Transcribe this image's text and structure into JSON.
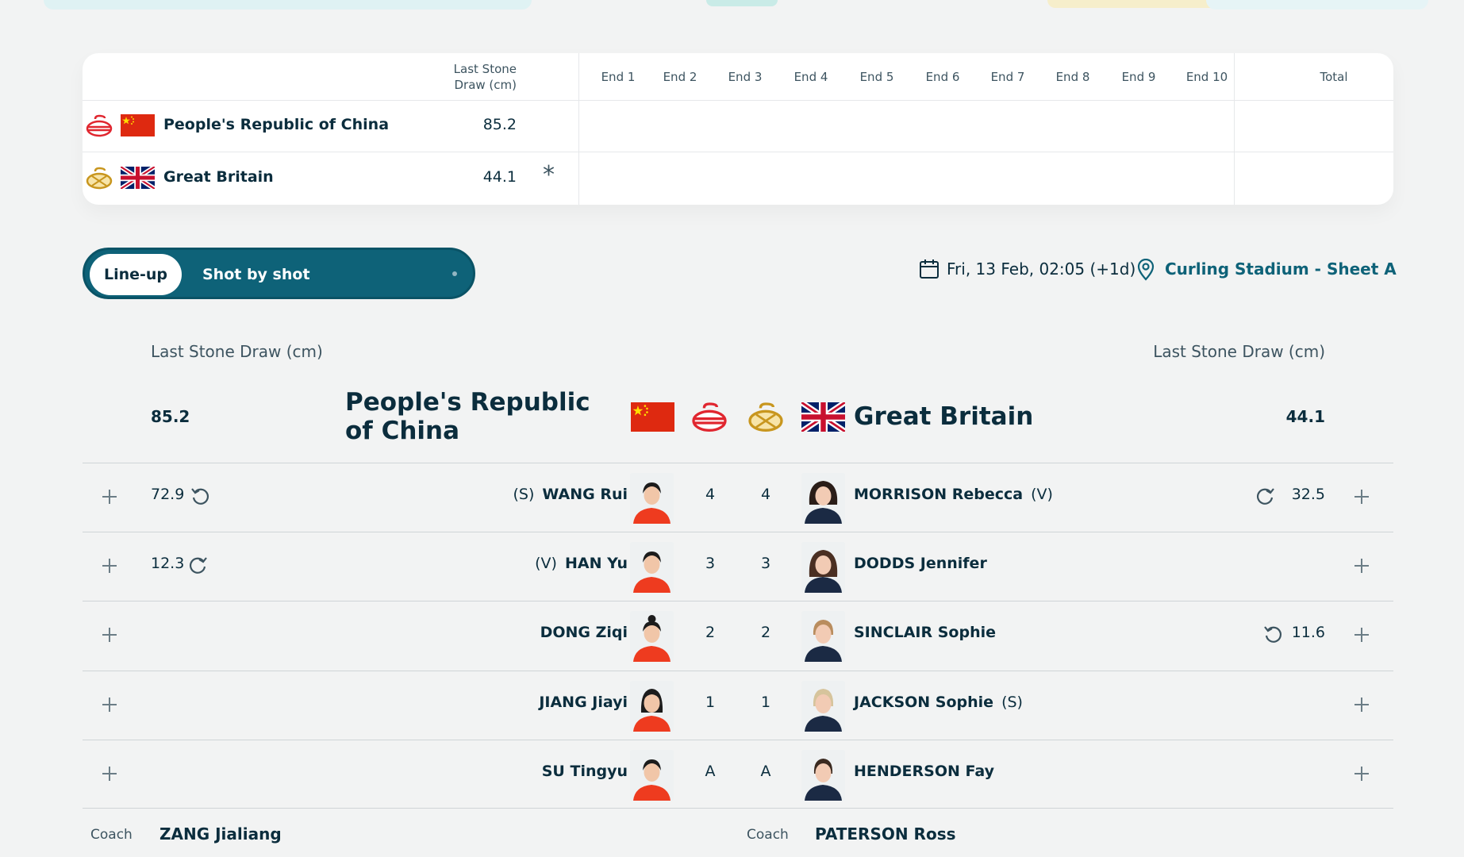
{
  "scoreboard": {
    "lsd_header": "Last Stone Draw (cm)",
    "ends": [
      "End 1",
      "End 2",
      "End 3",
      "End 4",
      "End 5",
      "End 6",
      "End 7",
      "End 8",
      "End 9",
      "End 10"
    ],
    "total_header": "Total",
    "hammer_symbol": "*",
    "teams": [
      {
        "name": "People's Republic of China",
        "lsd": "85.2",
        "stone_color": "#e0262f",
        "flag": "cn-flag"
      },
      {
        "name": "Great Britain",
        "lsd": "44.1",
        "stone_color": "#c8961e",
        "flag": "gb-flag"
      }
    ]
  },
  "toggle": {
    "active": "Line-up",
    "inactive": "Shot by shot"
  },
  "match_info": {
    "date": "Fri, 13 Feb, 02:05 (+1d)",
    "venue": "Curling Stadium - Sheet A"
  },
  "lineup": {
    "lsd_label": "Last Stone Draw (cm)",
    "left_team": {
      "name": "People's Republic of China",
      "lsd": "85.2"
    },
    "right_team": {
      "name": "Great Britain",
      "lsd": "44.1"
    },
    "rows": [
      {
        "left_shot": "72.9",
        "left_role": "(S)",
        "left_name": "WANG Rui",
        "left_pos": "4",
        "right_pos": "4",
        "right_name": "MORRISON Rebecca",
        "right_role": "(V)",
        "right_shot": "32.5"
      },
      {
        "left_shot": "12.3",
        "left_role": "(V)",
        "left_name": "HAN Yu",
        "left_pos": "3",
        "right_pos": "3",
        "right_name": "DODDS Jennifer",
        "right_role": "",
        "right_shot": ""
      },
      {
        "left_shot": "",
        "left_role": "",
        "left_name": "DONG Ziqi",
        "left_pos": "2",
        "right_pos": "2",
        "right_name": "SINCLAIR Sophie",
        "right_role": "",
        "right_shot": "11.6"
      },
      {
        "left_shot": "",
        "left_role": "",
        "left_name": "JIANG Jiayi",
        "left_pos": "1",
        "right_pos": "1",
        "right_name": "JACKSON Sophie",
        "right_role": "(S)",
        "right_shot": ""
      },
      {
        "left_shot": "",
        "left_role": "",
        "left_name": "SU Tingyu",
        "left_pos": "A",
        "right_pos": "A",
        "right_name": "HENDERSON Fay",
        "right_role": "",
        "right_shot": ""
      }
    ],
    "coach_label": "Coach",
    "left_coach": "ZANG Jialiang",
    "right_coach": "PATERSON Ross"
  },
  "colors": {
    "accent": "#0e6278",
    "text": "#0b2d3d",
    "china_red": "#e0262f",
    "gb_yellow": "#c8961e"
  }
}
